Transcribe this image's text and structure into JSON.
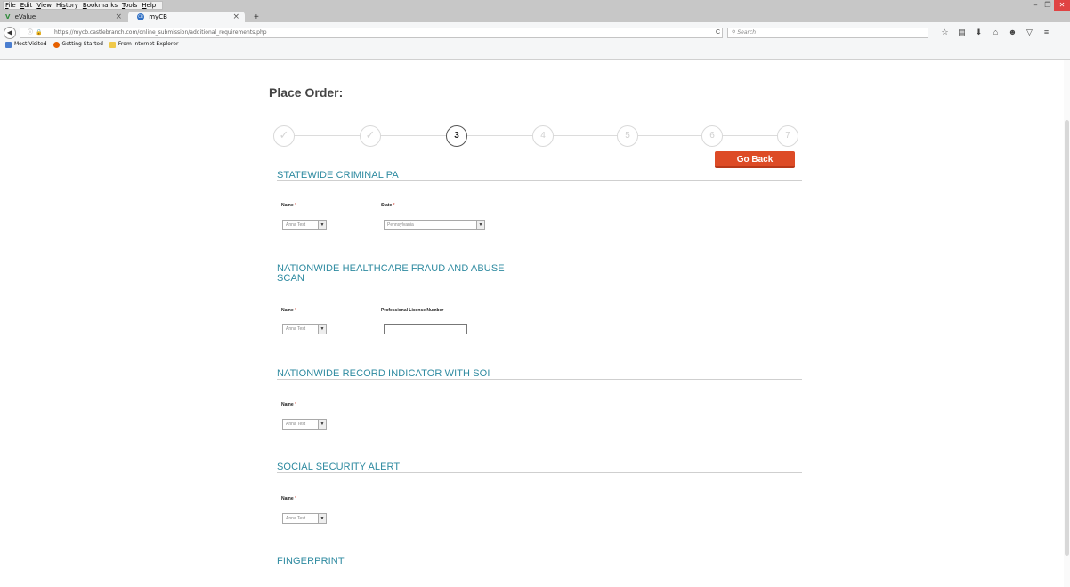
{
  "browser": {
    "menu": [
      "File",
      "Edit",
      "View",
      "History",
      "Bookmarks",
      "Tools",
      "Help"
    ],
    "menu_underline": [
      "F",
      "E",
      "V",
      "s",
      "B",
      "T",
      "H"
    ],
    "tabs": [
      {
        "label": "eValue",
        "favicon": "V",
        "active": false
      },
      {
        "label": "myCB",
        "favicon": "CB",
        "active": true
      }
    ],
    "new_tab": "+",
    "tab_close": "×",
    "url": "https://mycb.castlebranch.com/online_submission/additional_requirements.php",
    "search_placeholder": "Search",
    "window_controls": {
      "minimize": "–",
      "maximize": "❐",
      "close": "✕"
    },
    "bookmarks": [
      {
        "label": "Most Visited",
        "color": "#4a7ed0"
      },
      {
        "label": "Getting Started",
        "color": "#e66000"
      },
      {
        "label": "From Internet Explorer",
        "color": "#f0c94a"
      }
    ],
    "toolbar_icons": [
      "star-icon",
      "reading-list-icon",
      "download-icon",
      "home-icon",
      "smiley-icon",
      "pocket-icon",
      "menu-icon"
    ]
  },
  "page": {
    "title": "Place Order:",
    "steps": [
      {
        "label": "✓",
        "state": "done"
      },
      {
        "label": "✓",
        "state": "done"
      },
      {
        "label": "3",
        "state": "current"
      },
      {
        "label": "4",
        "state": "pending"
      },
      {
        "label": "5",
        "state": "pending"
      },
      {
        "label": "6",
        "state": "pending"
      },
      {
        "label": "7",
        "state": "pending"
      }
    ],
    "go_back": "Go Back",
    "required_mark": "*",
    "sections": [
      {
        "title": "STATEWIDE CRIMINAL PA",
        "name_label": "Name",
        "name_value": "Anna Test",
        "second_label": "State",
        "second_value": "Pennsylvania"
      },
      {
        "title_line1": "NATIONWIDE HEALTHCARE FRAUD AND ABUSE",
        "title_line2": "SCAN",
        "name_label": "Name",
        "name_value": "Anna Test",
        "second_label": "Professional License Number",
        "second_value": ""
      },
      {
        "title": "NATIONWIDE RECORD INDICATOR WITH SOI",
        "name_label": "Name",
        "name_value": "Anna Test"
      },
      {
        "title": "SOCIAL SECURITY ALERT",
        "name_label": "Name",
        "name_value": "Anna Test"
      },
      {
        "title": "FINGERPRINT"
      }
    ]
  },
  "colors": {
    "section_title": "#2e8aa0",
    "go_back_bg": "#dd4b26",
    "required": "#d0392b"
  }
}
